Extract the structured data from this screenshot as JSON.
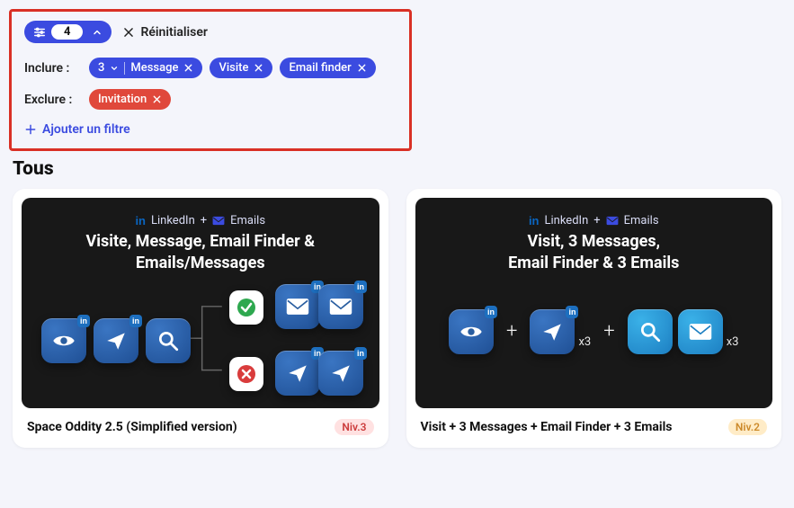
{
  "filter": {
    "count": "4",
    "reset": "Réinitialiser",
    "include_label": "Inclure :",
    "exclude_label": "Exclure :",
    "include_chips": {
      "first_count": "3",
      "first_label": "Message",
      "second": "Visite",
      "third": "Email finder"
    },
    "exclude_chips": {
      "first": "Invitation"
    },
    "add_filter": "Ajouter un filtre"
  },
  "section": {
    "title": "Tous"
  },
  "cards": [
    {
      "source_linkedin": "LinkedIn",
      "source_plus": "+",
      "source_emails": "Emails",
      "hero_title": "Visite, Message, Email Finder &\nEmails/Messages",
      "title": "Space Oddity 2.5 (Simplified version)",
      "level": "Niv.3"
    },
    {
      "source_linkedin": "LinkedIn",
      "source_plus": "+",
      "source_emails": "Emails",
      "hero_title": "Visit, 3 Messages,\nEmail Finder & 3 Emails",
      "mult1": "x3",
      "mult2": "x3",
      "title": "Visit + 3 Messages + Email Finder + 3 Emails",
      "level": "Niv.2"
    }
  ]
}
